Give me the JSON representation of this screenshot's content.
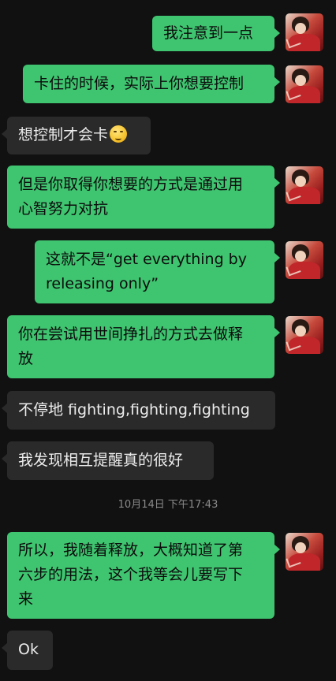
{
  "messages": [
    {
      "id": "m1",
      "side": "sent",
      "lines": [
        "我注意到一点"
      ]
    },
    {
      "id": "m2",
      "side": "sent",
      "lines": [
        "卡住的时候，实际上你想要控制"
      ]
    },
    {
      "id": "m3",
      "side": "received",
      "lines": [
        "想控制才会卡"
      ],
      "emoji": "thinking-face-icon"
    },
    {
      "id": "m4",
      "side": "sent",
      "lines": [
        "但是你取得你想要的方式是通过用",
        "心智努力对抗"
      ]
    },
    {
      "id": "m5",
      "side": "sent",
      "lines": [
        "这就不是“get everything by",
        "releasing only”"
      ]
    },
    {
      "id": "m6",
      "side": "sent",
      "lines": [
        "你在尝试用世间挣扎的方式去做释",
        "放"
      ]
    },
    {
      "id": "m7",
      "side": "received",
      "lines": [
        "不停地 fighting,fighting,fighting"
      ]
    },
    {
      "id": "m8",
      "side": "received",
      "lines": [
        "我发现相互提醒真的很好"
      ]
    },
    {
      "id": "m9",
      "side": "sent",
      "lines": [
        "所以，我随着释放，大概知道了第",
        "六步的用法，这个我等会儿要写下",
        "来"
      ]
    },
    {
      "id": "m10",
      "side": "received",
      "lines": [
        "Ok"
      ]
    }
  ],
  "timestamp": "10月14日 下午17:43",
  "colors": {
    "background": "#111111",
    "sent_bubble": "#3fc470",
    "received_bubble": "#2a2a2a",
    "timestamp_text": "#8a8a8a"
  }
}
